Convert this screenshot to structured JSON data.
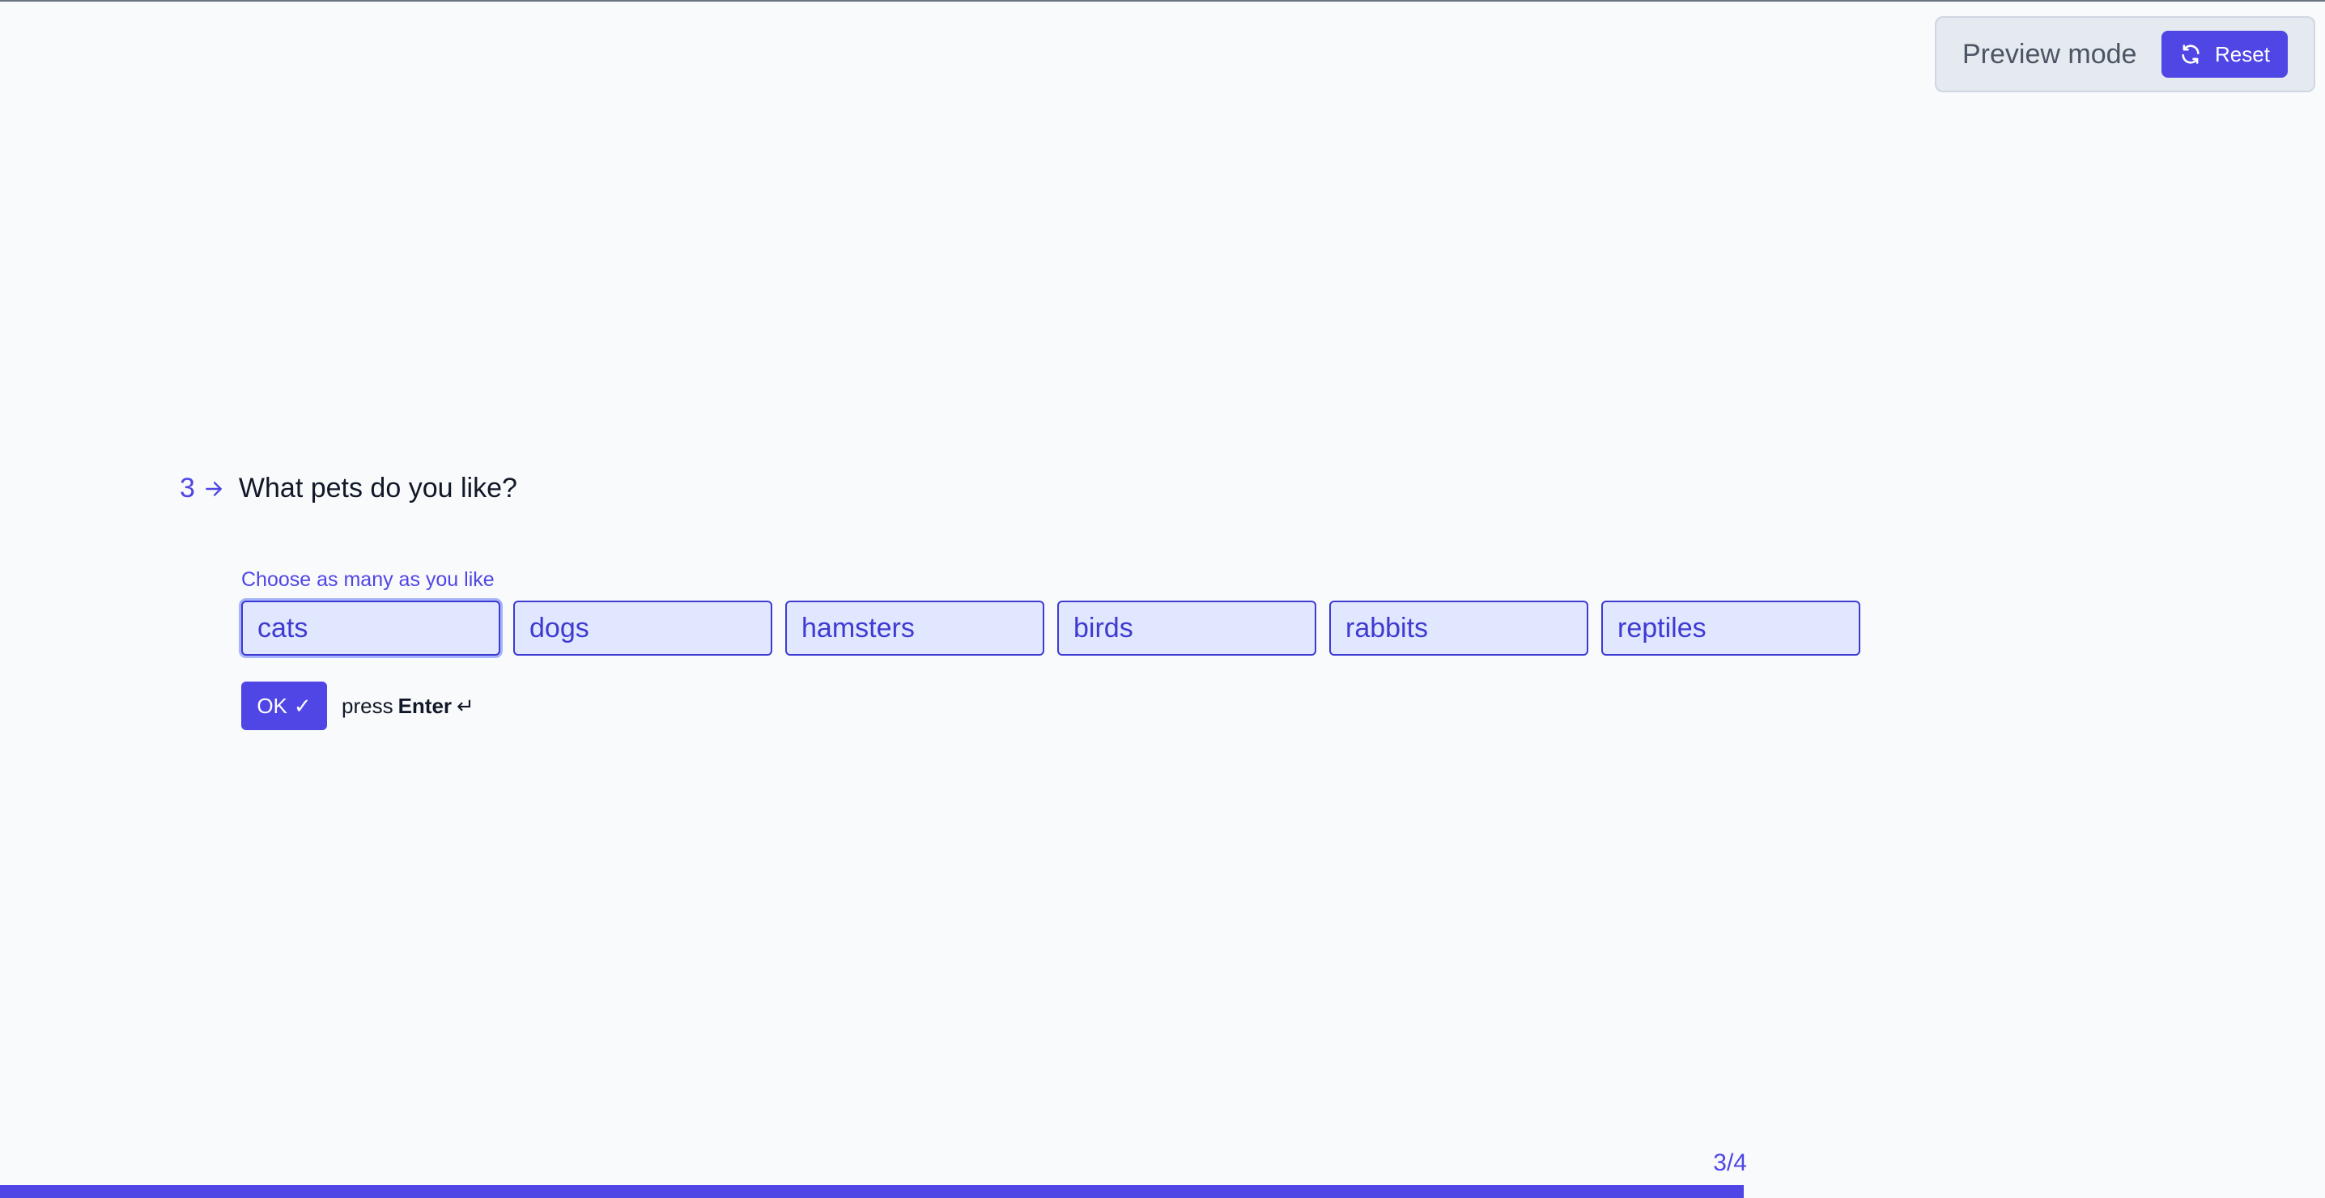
{
  "preview": {
    "label": "Preview mode",
    "reset_label": "Reset"
  },
  "question": {
    "number": "3",
    "title": "What pets do you like?",
    "hint": "Choose as many as you like",
    "options": [
      "cats",
      "dogs",
      "hamsters",
      "birds",
      "rabbits",
      "reptiles"
    ]
  },
  "actions": {
    "ok_label": "OK",
    "ok_check": "✓",
    "press_text": "press",
    "press_key": "Enter",
    "enter_glyph": "↵"
  },
  "progress": {
    "label": "3/4",
    "fraction": 0.75
  },
  "colors": {
    "accent": "#4f46e5",
    "option_bg": "#e0e7ff",
    "option_text": "#3f3ad1",
    "page_bg": "#f8fafc"
  },
  "icons": {
    "reset": "refresh-icon",
    "question_arrow": "arrow-right-icon",
    "ok": "check-icon",
    "enter": "enter-key-icon"
  }
}
